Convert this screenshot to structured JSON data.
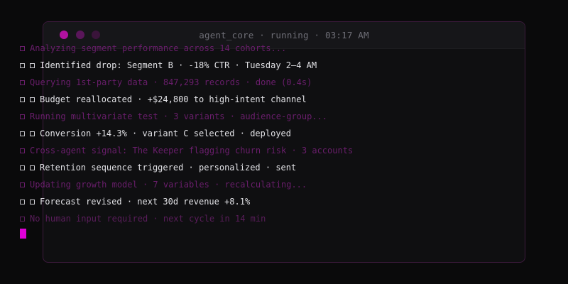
{
  "window": {
    "title": "agent_core · running · 03:17 AM",
    "controls": [
      {
        "name": "close",
        "color": "#b0129f"
      },
      {
        "name": "minimize",
        "color": "#5a165a"
      },
      {
        "name": "maximize",
        "color": "#3a143a"
      }
    ]
  },
  "log": {
    "lines": [
      {
        "text": "Analyzing segment performance across 14 cohorts...",
        "kind": "process"
      },
      {
        "text": "Identified drop: Segment B · -18% CTR · Tuesday 2–4 AM",
        "kind": "result"
      },
      {
        "text": "Querying 1st-party data · 847,293 records · done (0.4s)",
        "kind": "process"
      },
      {
        "text": "Budget reallocated · +$24,800 to high-intent channel",
        "kind": "result"
      },
      {
        "text": "Running multivariate test · 3 variants · audience-group...",
        "kind": "process"
      },
      {
        "text": "Conversion +14.3% · variant C selected · deployed",
        "kind": "result"
      },
      {
        "text": "Cross-agent signal: The Keeper flagging churn risk · 3 accounts",
        "kind": "process"
      },
      {
        "text": "Retention sequence triggered · personalized · sent",
        "kind": "result"
      },
      {
        "text": "Updating growth model · 7 variables · recalculating...",
        "kind": "process"
      },
      {
        "text": "Forecast revised · next 30d revenue +8.1%",
        "kind": "result"
      },
      {
        "text": "No human input required · next cycle in 14 min",
        "kind": "process-faint"
      }
    ]
  },
  "cursor": {
    "color": "#e000d8"
  },
  "colors": {
    "process": "#6a1e6c",
    "result": "#e2e2e6",
    "border": "#3d1a3d"
  }
}
